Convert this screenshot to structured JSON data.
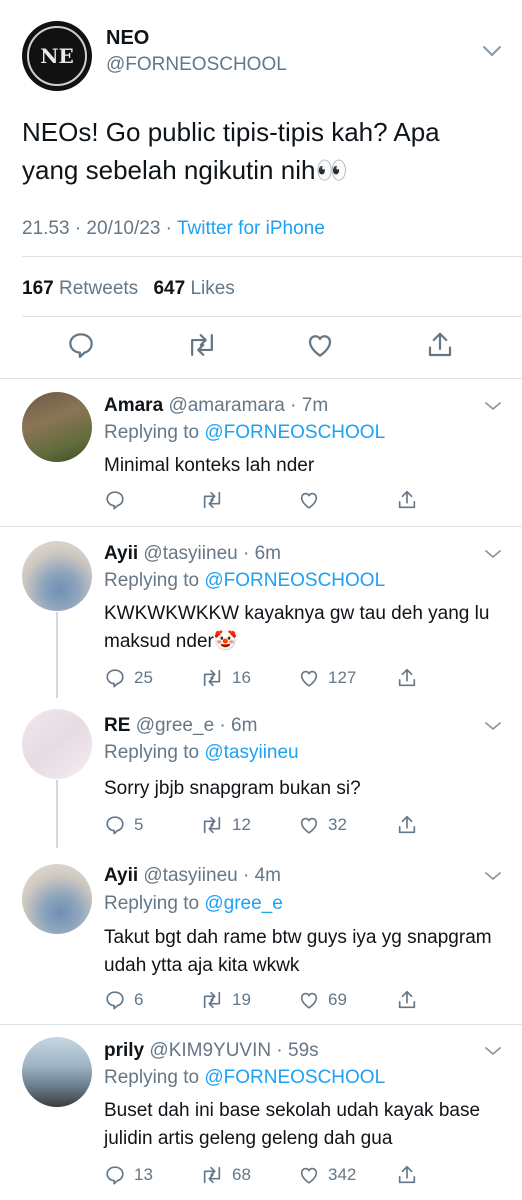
{
  "main": {
    "name": "NEO",
    "handle": "@FORNEOSCHOOL",
    "text": "NEOs! Go public tipis-tipis kah? Apa yang sebelah ngikutin nih👀",
    "time": "21.53 · 20/10/23 · ",
    "source": "Twitter for iPhone",
    "retweets_count": "167",
    "retweets_label": "Retweets",
    "likes_count": "647",
    "likes_label": "Likes",
    "avatar_crest": "NE"
  },
  "replies": [
    {
      "name": "Amara",
      "handle": "@amaramara",
      "time": "· 7m",
      "replying_label": "Replying to",
      "replying_to": "@FORNEOSCHOOL",
      "text": "Minimal konteks lah nder",
      "replies": "",
      "retweets": "",
      "likes": ""
    },
    {
      "name": "Ayii",
      "handle": "@tasyiineu",
      "time": "· 6m",
      "replying_label": "Replying to",
      "replying_to": "@FORNEOSCHOOL",
      "text": "KWKWKWKKW kayaknya gw tau deh yang lu maksud nder🤡",
      "replies": "25",
      "retweets": "16",
      "likes": "127"
    },
    {
      "name": "RE",
      "handle": "@gree_e",
      "time": "· 6m",
      "replying_label": "Replying to",
      "replying_to": "@tasyiineu",
      "text": "Sorry jbjb snapgram bukan si?",
      "replies": "5",
      "retweets": "12",
      "likes": "32"
    },
    {
      "name": "Ayii",
      "handle": "@tasyiineu",
      "time": "· 4m",
      "replying_label": "Replying to",
      "replying_to": "@gree_e",
      "text": "Takut bgt dah rame btw guys iya yg snapgram udah ytta aja kita wkwk",
      "replies": "6",
      "retweets": "19",
      "likes": "69"
    },
    {
      "name": "prily",
      "handle": "@KIM9YUVIN",
      "time": "· 59s",
      "replying_label": "Replying to",
      "replying_to": "@FORNEOSCHOOL",
      "text": "Buset dah ini base sekolah udah kayak base julidin artis geleng geleng dah gua",
      "replies": "13",
      "retweets": "68",
      "likes": "342"
    }
  ],
  "colors": {
    "link": "#1da1f2",
    "secondary": "#657786",
    "text": "#0f1419"
  },
  "icons": [
    "reply-icon",
    "retweet-icon",
    "like-icon",
    "share-icon",
    "chevron-down-icon"
  ]
}
